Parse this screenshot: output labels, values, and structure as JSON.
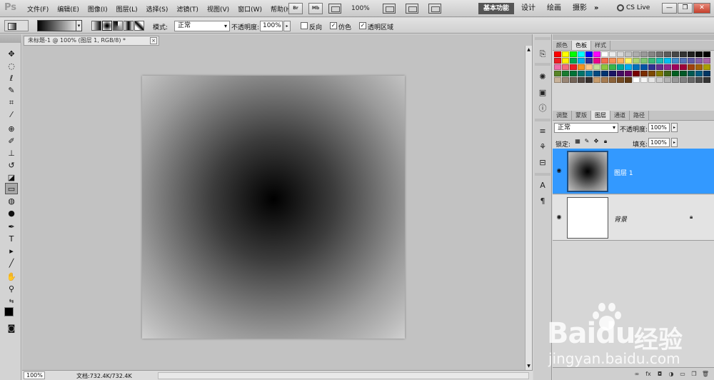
{
  "app": {
    "logo": "Ps"
  },
  "menu": [
    "文件(F)",
    "编辑(E)",
    "图像(I)",
    "图层(L)",
    "选择(S)",
    "滤镜(T)",
    "视图(V)",
    "窗口(W)",
    "帮助(H)"
  ],
  "menubar": {
    "bridge_label": "Br",
    "minibridge_label": "Mb",
    "zoom": "100%",
    "workspaces": {
      "active": "基本功能",
      "design": "设计",
      "painting": "绘画",
      "photography": "摄影",
      "more": "»"
    },
    "cs_live": "CS Live",
    "min": "—",
    "restore": "❐",
    "close": "✕"
  },
  "options": {
    "mode_label": "模式:",
    "mode_value": "正常",
    "opacity_label": "不透明度:",
    "opacity_value": "100%",
    "reverse_label": "反向",
    "dither_label": "仿色",
    "transparency_label": "透明区域",
    "reverse_checked": false,
    "dither_checked": true,
    "transparency_checked": true
  },
  "document": {
    "tab_title": "未标题-1 @ 100% (图层 1, RGB/8) *",
    "tab_close": "×"
  },
  "status": {
    "zoom": "100%",
    "doc_info": "文档:732.4K/732.4K"
  },
  "panels": {
    "top_tabs": [
      "颜色",
      "色板",
      "样式"
    ],
    "top_active": 1,
    "layer_tabs": [
      "调整",
      "蒙版",
      "图层",
      "通道",
      "路径"
    ],
    "layer_active": 2,
    "blend_mode": "正常",
    "opacity_label": "不透明度:",
    "opacity_value": "100%",
    "lock_label": "锁定:",
    "fill_label": "填充:",
    "fill_value": "100%",
    "layers": [
      {
        "name": "图层 1",
        "selected": true
      },
      {
        "name": "背景",
        "selected": false,
        "locked": true
      }
    ]
  },
  "watermark": {
    "brand": "Bai",
    "brand2": "du",
    "cn": "经验",
    "sub": "jingyan.baidu.com"
  },
  "swatch_colors": [
    "#ff0000",
    "#ffff00",
    "#00ff00",
    "#00ffff",
    "#0000ff",
    "#ff00ff",
    "#ffffff",
    "#ebebeb",
    "#d6d6d6",
    "#c2c2c2",
    "#adadad",
    "#999999",
    "#858585",
    "#707070",
    "#5c5c5c",
    "#474747",
    "#333333",
    "#1f1f1f",
    "#0a0a0a",
    "#000000",
    "#ee1d24",
    "#fff100",
    "#00a650",
    "#00aeef",
    "#2f3192",
    "#ed008c",
    "#f26c4f",
    "#f68e56",
    "#fbaf5d",
    "#fff467",
    "#acd372",
    "#7dc473",
    "#3bb878",
    "#1abbb4",
    "#00bff3",
    "#438ccb",
    "#5574b9",
    "#605ca8",
    "#855fa8",
    "#a763a8",
    "#f06eaa",
    "#f26d7d",
    "#ed1c24",
    "#f7941d",
    "#fdc689",
    "#c4df9b",
    "#8dc63f",
    "#39b54a",
    "#00a99d",
    "#00aeef",
    "#0072bc",
    "#0054a6",
    "#2e3192",
    "#662d91",
    "#92278f",
    "#9e005d",
    "#9e0039",
    "#a0410d",
    "#a36209",
    "#aba000",
    "#598527",
    "#197b30",
    "#007236",
    "#00746b",
    "#0076a3",
    "#004a80",
    "#003471",
    "#1b1464",
    "#440e62",
    "#630460",
    "#790000",
    "#7a2e00",
    "#7d4900",
    "#827b00",
    "#406618",
    "#005e20",
    "#005826",
    "#005952",
    "#005b7f",
    "#003663",
    "#c7b299",
    "#998675",
    "#736357",
    "#534741",
    "#362f2d",
    "#c69c6d",
    "#a67c52",
    "#8c6239",
    "#754c24",
    "#603913",
    "#ffffff",
    "#f5f5f5",
    "#e6e6e6",
    "#cccccc",
    "#b3b3b3",
    "#999999",
    "#808080",
    "#666666",
    "#4d4d4d",
    "#333333"
  ]
}
